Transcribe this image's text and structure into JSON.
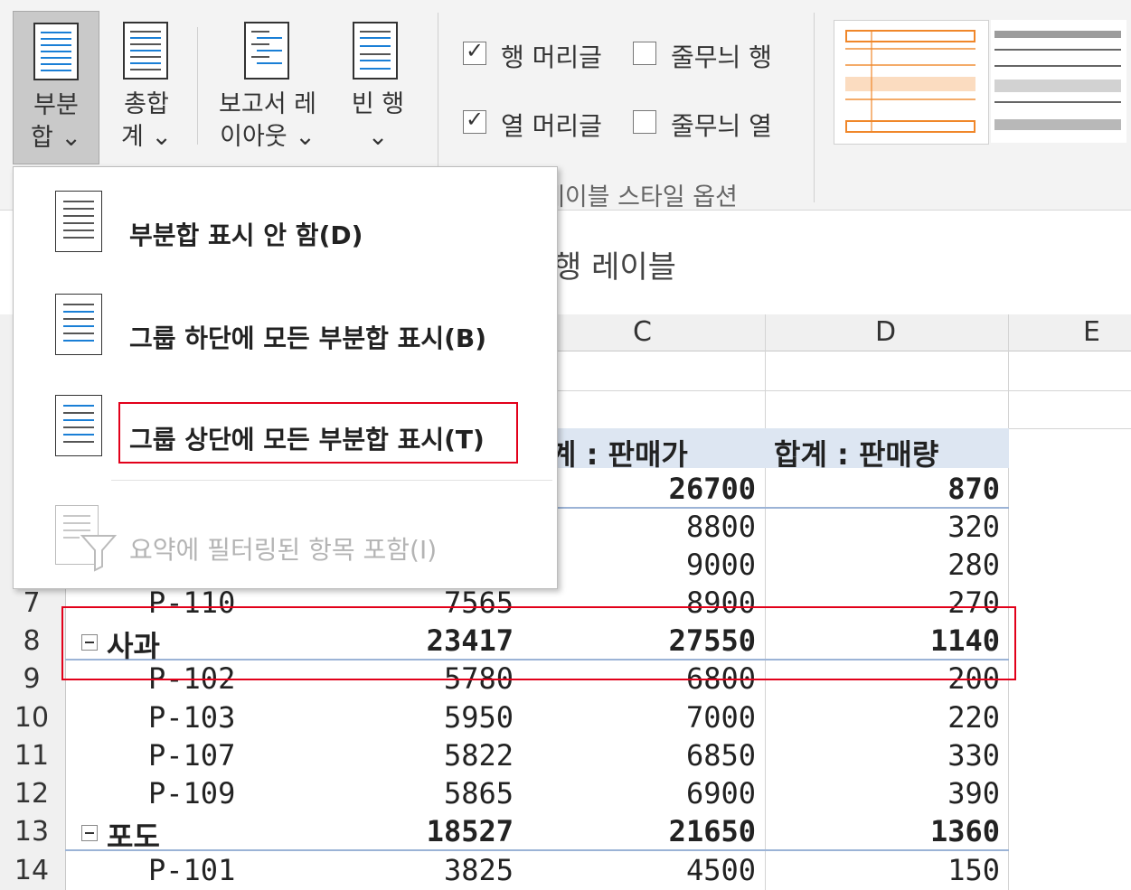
{
  "ribbon": {
    "buttons": [
      {
        "line1": "부분",
        "line2": "합 ⌄"
      },
      {
        "line1": "총합",
        "line2": "계 ⌄"
      },
      {
        "line1": "보고서 레",
        "line2": "이아웃 ⌄"
      },
      {
        "line1": "빈 행",
        "line2": "⌄"
      }
    ],
    "options": {
      "row_headers": "행 머리글",
      "banded_rows": "줄무늬 행",
      "col_headers": "열 머리글",
      "banded_cols": "줄무늬 열"
    },
    "group_label": "레이블 스타일 옵션",
    "accent": "#f0872a"
  },
  "menu": {
    "items": [
      {
        "label": "부분합 표시 안 함(D)"
      },
      {
        "label": "그룹 하단에 모든 부분합 표시(B)"
      },
      {
        "label": "그룹 상단에 모든 부분합 표시(T)"
      },
      {
        "label": "요약에 필터링된 항목 포함(I)"
      }
    ]
  },
  "sheet": {
    "pivot_caption": "행 레이블",
    "columns": [
      "C",
      "D",
      "E"
    ],
    "header_row": {
      "c": "계 : 판매가",
      "d": "합계 : 판매량"
    },
    "rows": [
      {
        "num": "",
        "a": "",
        "b": "",
        "c": "26700",
        "d": "870",
        "bold": true
      },
      {
        "num": "",
        "a": "",
        "b": "",
        "c": "8800",
        "d": "320"
      },
      {
        "num": "",
        "a": "",
        "b": "",
        "c": "9000",
        "d": "280"
      },
      {
        "num": "7",
        "a": "P-110",
        "b": "7565",
        "c": "8900",
        "d": "270"
      },
      {
        "num": "8",
        "a": "사과",
        "b": "23417",
        "c": "27550",
        "d": "1140",
        "bold": true
      },
      {
        "num": "9",
        "a": "P-102",
        "b": "5780",
        "c": "6800",
        "d": "200"
      },
      {
        "num": "10",
        "a": "P-103",
        "b": "5950",
        "c": "7000",
        "d": "220"
      },
      {
        "num": "11",
        "a": "P-107",
        "b": "5822",
        "c": "6850",
        "d": "330"
      },
      {
        "num": "12",
        "a": "P-109",
        "b": "5865",
        "c": "6900",
        "d": "390"
      },
      {
        "num": "13",
        "a": "포도",
        "b": "18527",
        "c": "21650",
        "d": "1360",
        "bold": true
      },
      {
        "num": "14",
        "a": "P-101",
        "b": "3825",
        "c": "4500",
        "d": "150"
      }
    ]
  },
  "highlight_color": "#e2001a"
}
